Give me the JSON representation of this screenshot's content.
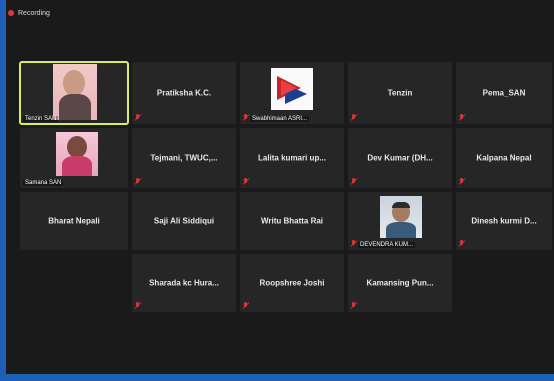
{
  "recording": {
    "label": "Recording"
  },
  "participants": [
    {
      "name": "Tenzin SAN",
      "video": true
    },
    {
      "name": "Pratiksha K.C."
    },
    {
      "name": "Swabhimaan ASRI...",
      "logo": true
    },
    {
      "name": "Tenzin"
    },
    {
      "name": "Pema_SAN"
    },
    {
      "name": "Samana SAN",
      "video": true
    },
    {
      "name": "Tejmani,  TWUC,..."
    },
    {
      "name": "Lalita kumari up..."
    },
    {
      "name": "Dev Kumar (DH..."
    },
    {
      "name": "Kalpana Nepal"
    },
    {
      "name": "Bharat Nepali"
    },
    {
      "name": "Saji Ali Siddiqui"
    },
    {
      "name": "Writu Bhatta Rai"
    },
    {
      "name": "DEVENDRA KUM...",
      "video": true
    },
    {
      "name": "Dinesh kurmi D..."
    },
    {
      "name": "Sharada kc Hura..."
    },
    {
      "name": "Roopshree Joshi"
    },
    {
      "name": "Kamansing Pun..."
    }
  ],
  "colors": {
    "active_border": "#d7f05a",
    "tile_bg": "#262626",
    "window_bg": "#1a1a1a",
    "muted_icon": "#d33333"
  }
}
